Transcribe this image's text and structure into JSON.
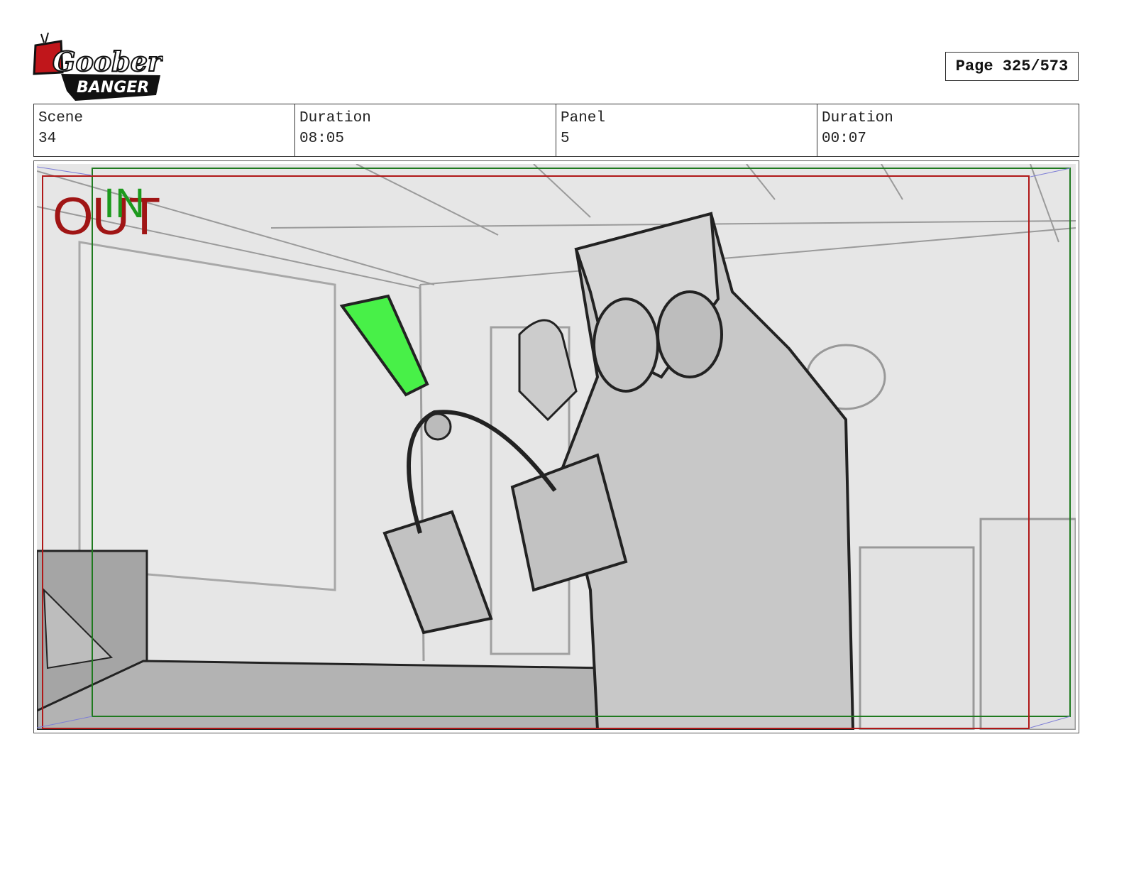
{
  "logo": {
    "line1": "Goober",
    "line2": "BANGER"
  },
  "page": {
    "label": "Page 325/573"
  },
  "info": [
    {
      "label": "Scene",
      "value": "34"
    },
    {
      "label": "Duration",
      "value": "08:05"
    },
    {
      "label": "Panel",
      "value": "5"
    },
    {
      "label": "Duration",
      "value": "00:07"
    }
  ],
  "frame_labels": {
    "out": "OUT",
    "in": "IN"
  },
  "colors": {
    "out_frame": "#b01818",
    "in_frame": "#1f7a1f",
    "highlight": "#48f048",
    "sketch_line": "#222222",
    "background": "#e4e4e4"
  }
}
